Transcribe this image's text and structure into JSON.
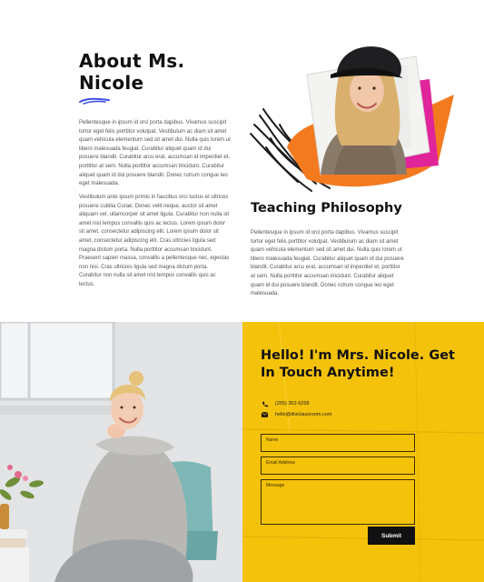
{
  "about": {
    "title": "About Ms. Nicole",
    "paragraph1": "Pellentesque in ipsum id orci porta dapibus. Vivamus suscipit tortor eget felis porttitor volutpat. Vestibulum ac diam sit amet quam vehicula elementum sed sit amet dui. Nulla quis lorem ut libero malesuada feugiat. Curabitur aliquet quam id dui posuere blandit. Curabitur arcu erat, accumsan id imperdiet et, porttitor at sem. Nulla porttitor accumsan tincidunt. Curabitur aliquet quam id dui posuere blandit. Donec rutrum congue leo eget malesuada.",
    "paragraph2": "Vestibulum ante ipsum primis in faucibus orci luctus et ultrices posuere cubilia Curae; Donec velit neque, auctor sit amet aliquam vel, ullamcorper sit amet ligula. Curabitur non nulla sit amet nisl tempus convallis quis ac lectus. Lorem ipsum dolor sit amet, consectetur adipiscing elit. Lorem ipsum dolor sit amet, consectetur adipiscing elit. Cras ultricies ligula sed magna dictum porta. Nulla porttitor accumsan tincidunt. Praesent sapien massa, convallis a pellentesque nec, egestas non nisi. Cras ultricies ligula sed magna dictum porta. Curabitur non nulla sit amet nisl tempus convallis quis ac lectus."
  },
  "philosophy": {
    "title": "Teaching Philosophy",
    "paragraph": "Pellentesque in ipsum id orci porta dapibus. Vivamus suscipit tortor eget felis porttitor volutpat. Vestibulum ac diam sit amet quam vehicula elementum sed sit amet dui. Nulla quis lorem ut libero malesuada feugiat. Curabitur aliquet quam id dui posuere blandit. Curabitur arcu erat, accumsan id imperdiet et, porttitor at sem. Nulla porttitor accumsan tincidunt. Curabitur aliquet quam id dui posuere blandit. Donec rutrum congue leo eget malesuada."
  },
  "contact": {
    "title": "Hello! I'm Mrs. Nicole. Get In Touch Anytime!",
    "phone": "(255) 352-6258",
    "email": "hello@diviclassroom.com",
    "name_placeholder": "Name",
    "email_placeholder": "Email Address",
    "message_placeholder": "Message",
    "submit_label": "Submit"
  },
  "colors": {
    "accent_yellow": "#f5c20b",
    "squiggle_blue": "#3b4fe0",
    "orange": "#f47a20",
    "magenta": "#e0249a"
  }
}
